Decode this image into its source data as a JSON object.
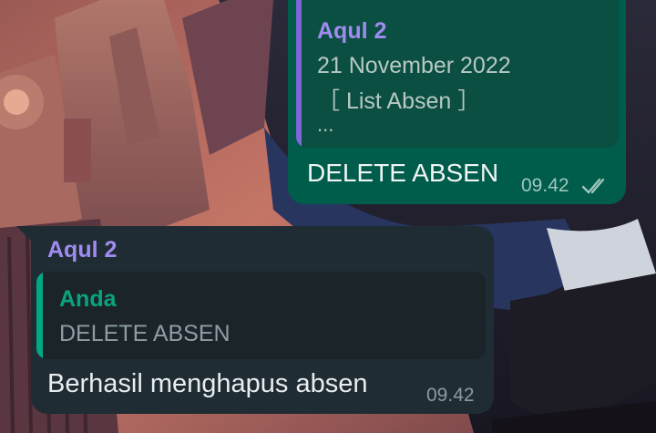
{
  "chat": {
    "outgoing": {
      "quote": {
        "sender": "Aqul 2",
        "line1": "21 November 2022",
        "line2": "［ List Absen ］",
        "line3": "..."
      },
      "text": "DELETE ABSEN",
      "time": "09.42",
      "status_icon": "double-check-icon"
    },
    "incoming": {
      "sender": "Aqul 2",
      "quote": {
        "sender": "Anda",
        "text": "DELETE ABSEN"
      },
      "text": "Berhasil menghapus absen",
      "time": "09.42"
    }
  },
  "colors": {
    "outgoing_bubble": "#005c4b",
    "incoming_bubble": "#1f2c33",
    "sender_name": "#a08cf0",
    "quote_bar_outgoing": "#7f66d9",
    "quote_bar_incoming": "#02a884",
    "quote_sender_incoming": "#0aa47c"
  }
}
